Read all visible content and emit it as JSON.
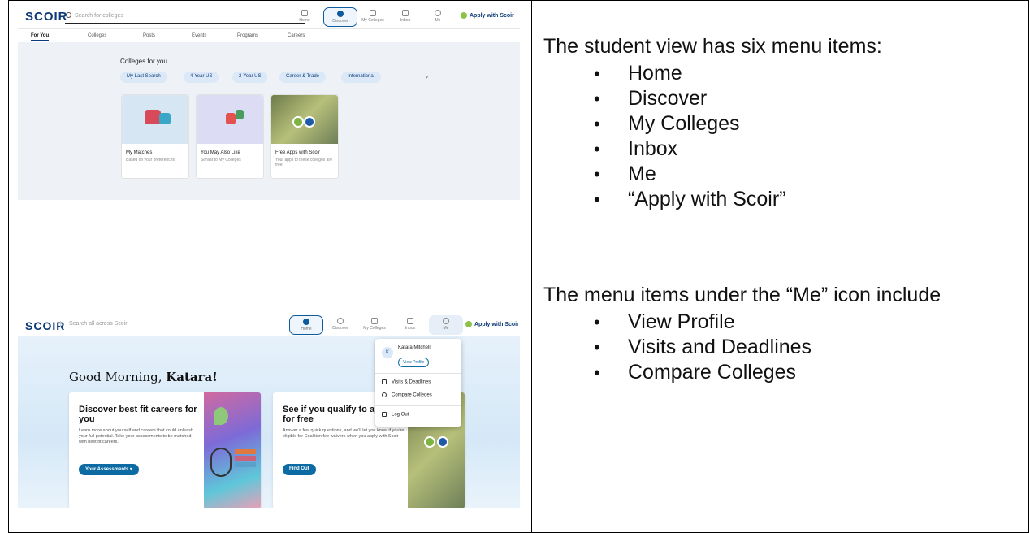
{
  "row1": {
    "description": {
      "intro": "The student view has six menu items:",
      "items": [
        "Home",
        "Discover",
        "My Colleges",
        "Inbox",
        "Me",
        "“Apply with Scoir”"
      ]
    },
    "screenshot": {
      "logo": "SCOIR",
      "search_placeholder": "Search for colleges",
      "nav": [
        "Home",
        "Discover",
        "My Colleges",
        "Inbox",
        "Me"
      ],
      "apply": "Apply with Scoir",
      "subtabs": [
        "For You",
        "Colleges",
        "Posts",
        "Events",
        "Programs",
        "Careers"
      ],
      "section_title": "Colleges for you",
      "pills": [
        "My Last Search",
        "4-Year US",
        "2-Year US",
        "Career & Trade",
        "International"
      ],
      "cards": [
        {
          "title": "My Matches",
          "sub": "Based on your preferences"
        },
        {
          "title": "You May Also Like",
          "sub": "Similar to My Colleges"
        },
        {
          "title": "Free Apps with Scoir",
          "sub": "Your apps to these colleges are free"
        }
      ]
    }
  },
  "row2": {
    "description": {
      "intro": "The menu items under the “Me” icon include",
      "items": [
        "View Profile",
        "Visits and Deadlines",
        "Compare Colleges"
      ]
    },
    "screenshot": {
      "logo": "SCOIR",
      "search_placeholder": "Search all across Scoir",
      "nav": [
        "Home",
        "Discover",
        "My Colleges",
        "Inbox",
        "Me"
      ],
      "apply": "Apply with Scoir",
      "greeting_prefix": "Good Morning,",
      "greeting_name": "Katara!",
      "card1": {
        "title": "Discover best fit careers for you",
        "body": "Learn more about yourself and careers that could unleash your full potential. Take your assessments to be matched with best fit careers.",
        "button": "Your Assessments"
      },
      "card2": {
        "title": "See if you qualify to apply for free",
        "body": "Answer a few quick questions, and we'll let you know if you're eligible for Coalition fee waivers when you apply with Scoir",
        "button": "Find Out"
      },
      "menu": {
        "avatar": "K",
        "name": "Katara Mitchell",
        "view_profile": "View Profile",
        "visits": "Visits & Deadlines",
        "compare": "Compare Colleges",
        "logout": "Log Out"
      }
    }
  }
}
